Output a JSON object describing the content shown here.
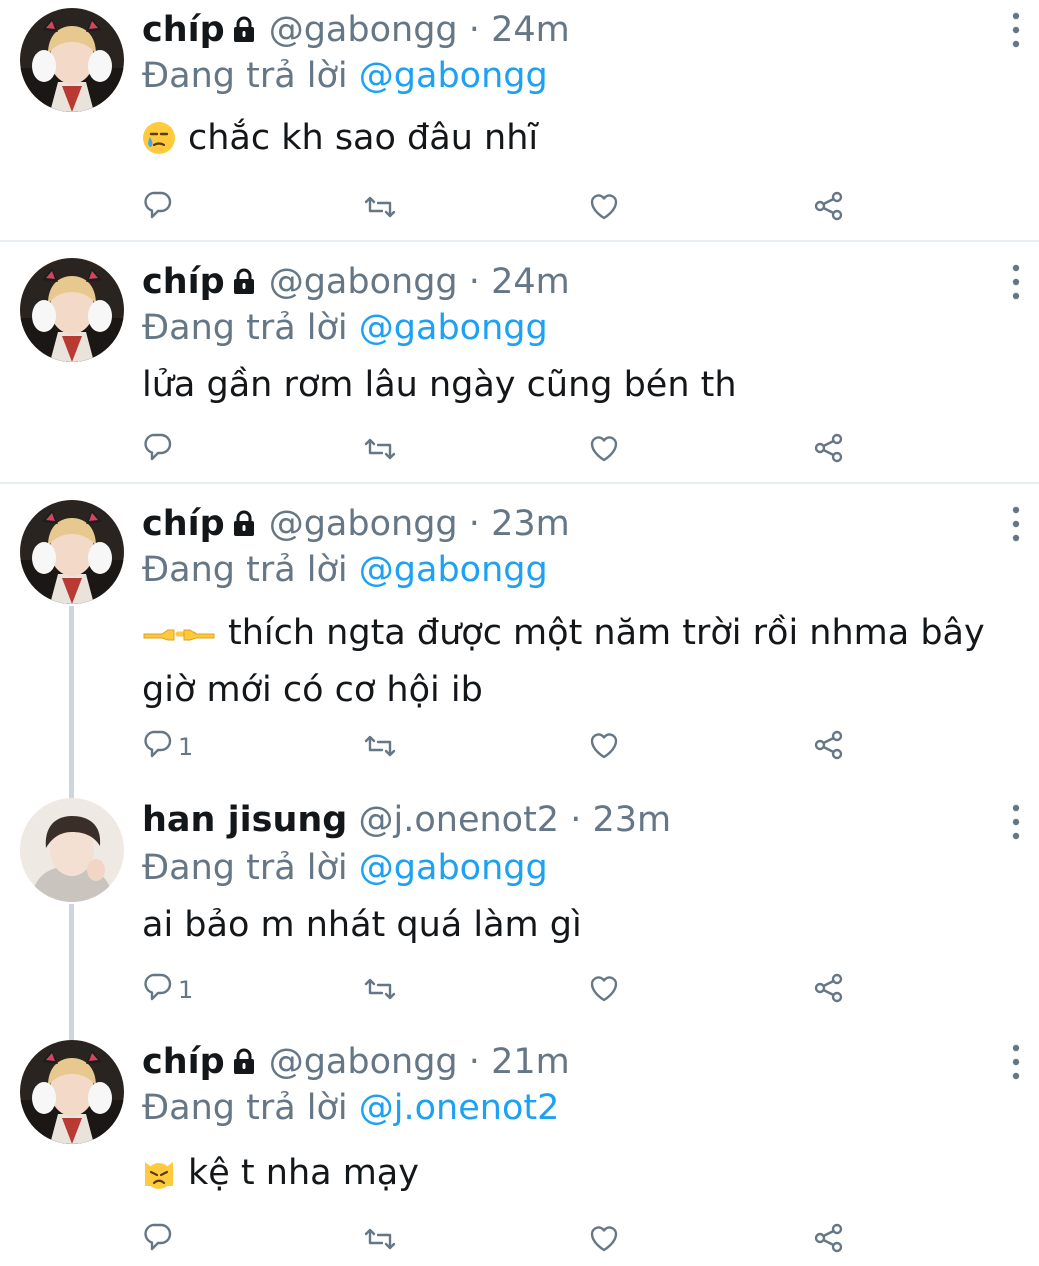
{
  "tweets": [
    {
      "name": "chíp",
      "handle": "@gabongg",
      "sep": "·",
      "time": "24m",
      "reply_prefix": "Đang trả lời",
      "reply_to": "@gabongg",
      "text": "chắc kh sao đâu nhĩ",
      "emoji": "crying-face-emoji",
      "reply_count": ""
    },
    {
      "name": "chíp",
      "handle": "@gabongg",
      "sep": "·",
      "time": "24m",
      "reply_prefix": "Đang trả lời",
      "reply_to": "@gabongg",
      "text": "lửa gần rơm lâu ngày cũng bén th",
      "reply_count": ""
    },
    {
      "name": "chíp",
      "handle": "@gabongg",
      "sep": "·",
      "time": "23m",
      "reply_prefix": "Đang trả lời",
      "reply_to": "@gabongg",
      "text": "thích ngta được một năm trời rồi nhma bây giờ mới có cơ hội ib",
      "emoji": "pointing-fingers-emoji",
      "reply_count": "1"
    },
    {
      "name": "han jisung",
      "handle": "@j.onenot2",
      "sep": "·",
      "time": "23m",
      "reply_prefix": "Đang trả lời",
      "reply_to": "@gabongg",
      "text": "ai bảo m nhát quá làm gì",
      "reply_count": "1"
    },
    {
      "name": "chíp",
      "handle": "@gabongg",
      "sep": "·",
      "time": "21m",
      "reply_prefix": "Đang trả lời",
      "reply_to": "@j.onenot2",
      "text": "kệ t nha mạy",
      "emoji": "pouting-cat-emoji",
      "reply_count": ""
    }
  ],
  "icons": {
    "reply": "reply-icon",
    "retweet": "retweet-icon",
    "like": "heart-icon",
    "share": "share-icon",
    "more": "more-icon",
    "lock": "lock-icon"
  },
  "colors": {
    "text": "#14171a",
    "secondary": "#657786",
    "link": "#1da1f2",
    "divider": "#e6ecf0",
    "thread_line": "#ccd6dd"
  }
}
